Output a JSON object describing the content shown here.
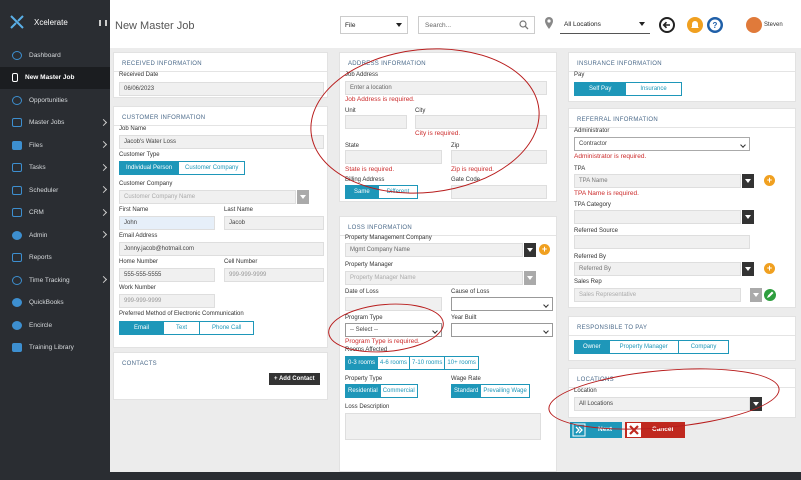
{
  "app": {
    "name": "Xcelerate"
  },
  "sidebar": {
    "items": [
      {
        "label": "Dashboard"
      },
      {
        "label": "New Master Job"
      },
      {
        "label": "Opportunities"
      },
      {
        "label": "Master Jobs"
      },
      {
        "label": "Files"
      },
      {
        "label": "Tasks"
      },
      {
        "label": "Scheduler"
      },
      {
        "label": "CRM"
      },
      {
        "label": "Admin"
      },
      {
        "label": "Reports"
      },
      {
        "label": "Time Tracking"
      },
      {
        "label": "QuickBooks"
      },
      {
        "label": "Encircle"
      },
      {
        "label": "Training Library"
      }
    ]
  },
  "header": {
    "title": "New Master Job",
    "file_select": "File",
    "search_placeholder": "Search...",
    "location_select": "All Locations",
    "user_name": "Steven"
  },
  "received": {
    "heading": "RECEIVED INFORMATION",
    "date_label": "Received Date",
    "date_value": "06/06/2023"
  },
  "customer": {
    "heading": "CUSTOMER INFORMATION",
    "job_name_label": "Job Name",
    "job_name_value": "Jacob's Water Loss",
    "type_label": "Customer Type",
    "type_options": [
      "Individual Person",
      "Customer Company"
    ],
    "company_label": "Customer Company",
    "company_placeholder": "Customer Company Name",
    "first_name_label": "First Name",
    "first_name_value": "John",
    "last_name_label": "Last Name",
    "last_name_value": "Jacob",
    "email_label": "Email Address",
    "email_value": "Jonny.jacob@hotmail.com",
    "home_label": "Home Number",
    "home_value": "555-555-5555",
    "cell_label": "Cell Number",
    "cell_placeholder": "999-999-9999",
    "work_label": "Work Number",
    "work_placeholder": "999-999-9999",
    "comm_label": "Preferred Method of Electronic Communication",
    "comm_options": [
      "Email",
      "Text",
      "Phone Call"
    ]
  },
  "contacts": {
    "heading": "CONTACTS",
    "add_button": "+ Add Contact"
  },
  "address": {
    "heading": "ADDRESS INFORMATION",
    "job_address_label": "Job Address",
    "job_address_placeholder": "Enter a location",
    "job_address_error": "Job Address is required.",
    "unit_label": "Unit",
    "city_label": "City",
    "city_error": "City is required.",
    "state_label": "State",
    "zip_label": "Zip",
    "state_error": "State is required.",
    "zip_error": "Zip is required.",
    "billing_label": "Billing Address",
    "billing_options": [
      "Same",
      "Different"
    ],
    "gate_label": "Gate Code"
  },
  "loss": {
    "heading": "LOSS INFORMATION",
    "pm_company_label": "Property Management Company",
    "pm_company_placeholder": "Mgmt Company Name",
    "pm_label": "Property Manager",
    "pm_placeholder": "Property Manager Name",
    "date_label": "Date of Loss",
    "cause_label": "Cause of Loss",
    "program_label": "Program Type",
    "program_value": "-- Select --",
    "program_error": "Program Type is required.",
    "year_label": "Year Built",
    "rooms_label": "Rooms Affected",
    "rooms_options": [
      "0-3 rooms",
      "4-6 rooms",
      "7-10 rooms",
      "10+ rooms"
    ],
    "ptype_label": "Property Type",
    "ptype_options": [
      "Residential",
      "Commercial"
    ],
    "wage_label": "Wage Rate",
    "wage_options": [
      "Standard",
      "Prevailing Wage"
    ],
    "desc_label": "Loss Description"
  },
  "insurance": {
    "heading": "INSURANCE INFORMATION",
    "pay_label": "Pay",
    "pay_options": [
      "Self Pay",
      "Insurance"
    ]
  },
  "referral": {
    "heading": "REFERRAL INFORMATION",
    "admin_label": "Administrator",
    "admin_value": "Contractor",
    "admin_error": "Administrator is required.",
    "tpa_label": "TPA",
    "tpa_placeholder": "TPA Name",
    "tpa_error": "TPA Name is required.",
    "tpa_cat_label": "TPA Category",
    "ref_source_label": "Referred Source",
    "ref_by_label": "Referred By",
    "ref_by_placeholder": "Referred By",
    "sales_label": "Sales Rep",
    "sales_placeholder": "Sales Representative"
  },
  "responsible": {
    "heading": "RESPONSIBLE TO PAY",
    "options": [
      "Owner",
      "Property Manager",
      "Company"
    ]
  },
  "locations": {
    "heading": "LOCATIONS",
    "location_label": "Location",
    "location_value": "All Locations"
  },
  "actions": {
    "next": "Next",
    "cancel": "Cancel"
  },
  "colors": {
    "accent": "#1e97b9",
    "error": "#cc2b2b",
    "sidebar": "#2a2d32",
    "orange": "#f0a020",
    "green": "#2e9e3e"
  }
}
